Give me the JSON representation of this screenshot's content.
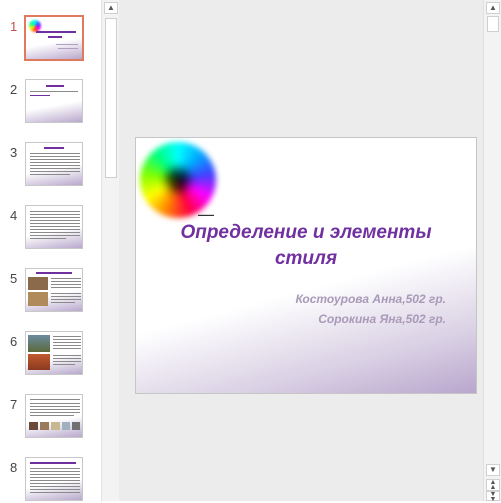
{
  "thumbnails": [
    {
      "number": "1",
      "selected": true
    },
    {
      "number": "2",
      "selected": false
    },
    {
      "number": "3",
      "selected": false
    },
    {
      "number": "4",
      "selected": false
    },
    {
      "number": "5",
      "selected": false
    },
    {
      "number": "6",
      "selected": false
    },
    {
      "number": "7",
      "selected": false
    },
    {
      "number": "8",
      "selected": false
    }
  ],
  "slide": {
    "title": "Определение и элементы стиля",
    "authors": [
      "Костоурова Анна,502 гр.",
      "Сорокина Яна,502 гр."
    ]
  },
  "scroll_icons": {
    "up": "scroll-up-icon",
    "down": "scroll-down-icon",
    "prev_slide": "previous-slide-icon",
    "next_slide": "next-slide-icon"
  },
  "colors": {
    "accent_selected": "#e07a5f",
    "title": "#7030a0",
    "author": "#a89ab8"
  }
}
